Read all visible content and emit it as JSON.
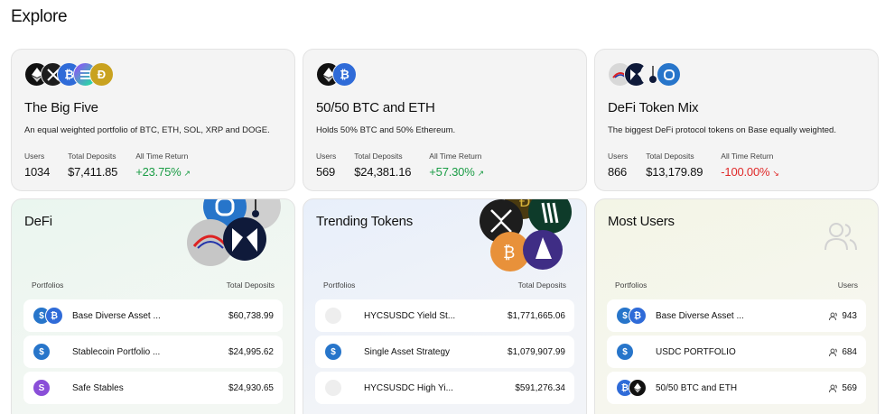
{
  "page": {
    "title": "Explore"
  },
  "featured": [
    {
      "title": "The Big Five",
      "description": "An equal weighted portfolio of BTC, ETH, SOL, XRP and DOGE.",
      "users_label": "Users",
      "users": "1034",
      "deposits_label": "Total Deposits",
      "deposits": "$7,411.85",
      "return_label": "All Time Return",
      "return": "+23.75%",
      "icons": [
        "eth-icon",
        "xrp-icon",
        "btc-icon",
        "sol-icon",
        "doge-icon"
      ]
    },
    {
      "title": "50/50 BTC and ETH",
      "description": "Holds 50% BTC and 50% Ethereum.",
      "users_label": "Users",
      "users": "569",
      "deposits_label": "Total Deposits",
      "deposits": "$24,381.16",
      "return_label": "All Time Return",
      "return": "+57.30%",
      "icons": [
        "eth-icon",
        "btc-icon"
      ]
    },
    {
      "title": "DeFi Token Mix",
      "description": "The biggest DeFi protocol tokens on Base equally weighted.",
      "users_label": "Users",
      "users": "866",
      "deposits_label": "Total Deposits",
      "deposits": "$13,179.89",
      "return_label": "All Time Return",
      "return": "-100.00%",
      "icons": [
        "aerodrome-icon",
        "morpho-icon",
        "pendle-icon",
        "spectra-icon"
      ]
    }
  ],
  "lists": [
    {
      "title": "DeFi",
      "col_left": "Portfolios",
      "col_right": "Total Deposits",
      "rows": [
        {
          "name": "Base Diverse Asset ...",
          "value": "$60,738.99"
        },
        {
          "name": "Stablecoin Portfolio ...",
          "value": "$24,995.62"
        },
        {
          "name": "Safe Stables",
          "value": "$24,930.65"
        }
      ]
    },
    {
      "title": "Trending Tokens",
      "col_left": "Portfolios",
      "col_right": "Total Deposits",
      "rows": [
        {
          "name": "HYCSUSDC Yield St...",
          "value": "$1,771,665.06"
        },
        {
          "name": "Single Asset Strategy",
          "value": "$1,079,907.99"
        },
        {
          "name": "HYCSUSDC High Yi...",
          "value": "$591,276.34"
        }
      ]
    },
    {
      "title": "Most Users",
      "col_left": "Portfolios",
      "col_right": "Users",
      "rows": [
        {
          "name": "Base Diverse Asset ...",
          "value": "943"
        },
        {
          "name": "USDC PORTFOLIO",
          "value": "684"
        },
        {
          "name": "50/50 BTC and ETH",
          "value": "569"
        }
      ]
    }
  ],
  "colors": {
    "positive": "#1a9c45",
    "negative": "#e02929",
    "btc": "#2f6bd8",
    "eth": "#111111",
    "usdc": "#2775ca",
    "doge": "#c9a21f"
  }
}
